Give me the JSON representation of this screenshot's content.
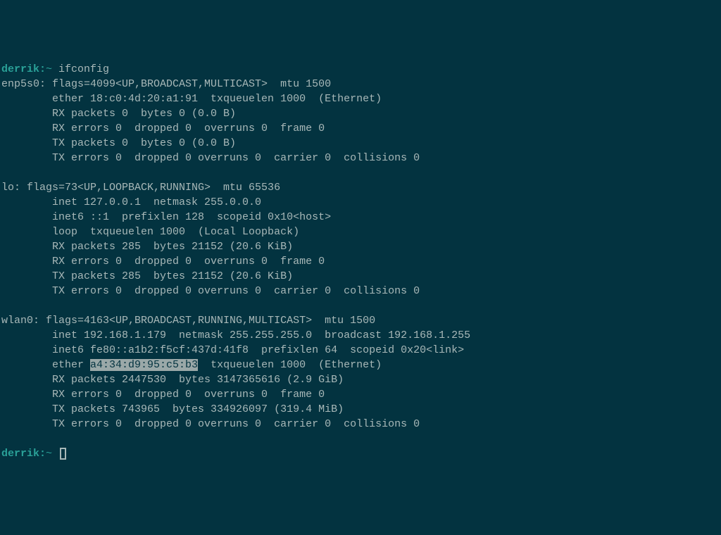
{
  "prompt": {
    "user_host": "derrik:",
    "path": "~",
    "command": "ifconfig"
  },
  "interfaces": {
    "enp5s0": {
      "header": "enp5s0: flags=4099<UP,BROADCAST,MULTICAST>  mtu 1500",
      "ether": "        ether 18:c0:4d:20:a1:91  txqueuelen 1000  (Ethernet)",
      "rx_packets": "        RX packets 0  bytes 0 (0.0 B)",
      "rx_errors": "        RX errors 0  dropped 0  overruns 0  frame 0",
      "tx_packets": "        TX packets 0  bytes 0 (0.0 B)",
      "tx_errors": "        TX errors 0  dropped 0 overruns 0  carrier 0  collisions 0"
    },
    "lo": {
      "header": "lo: flags=73<UP,LOOPBACK,RUNNING>  mtu 65536",
      "inet": "        inet 127.0.0.1  netmask 255.0.0.0",
      "inet6": "        inet6 ::1  prefixlen 128  scopeid 0x10<host>",
      "loop": "        loop  txqueuelen 1000  (Local Loopback)",
      "rx_packets": "        RX packets 285  bytes 21152 (20.6 KiB)",
      "rx_errors": "        RX errors 0  dropped 0  overruns 0  frame 0",
      "tx_packets": "        TX packets 285  bytes 21152 (20.6 KiB)",
      "tx_errors": "        TX errors 0  dropped 0 overruns 0  carrier 0  collisions 0"
    },
    "wlan0": {
      "header": "wlan0: flags=4163<UP,BROADCAST,RUNNING,MULTICAST>  mtu 1500",
      "inet": "        inet 192.168.1.179  netmask 255.255.255.0  broadcast 192.168.1.255",
      "inet6": "        inet6 fe80::a1b2:f5cf:437d:41f8  prefixlen 64  scopeid 0x20<link>",
      "ether_pre": "        ether ",
      "ether_mac": "a4:34:d9:95:c5:b3",
      "ether_post": "  txqueuelen 1000  (Ethernet)",
      "rx_packets": "        RX packets 2447530  bytes 3147365616 (2.9 GiB)",
      "rx_errors": "        RX errors 0  dropped 0  overruns 0  frame 0",
      "tx_packets": "        TX packets 743965  bytes 334926097 (319.4 MiB)",
      "tx_errors": "        TX errors 0  dropped 0 overruns 0  carrier 0  collisions 0"
    }
  },
  "prompt2": {
    "user_host": "derrik:",
    "path": "~"
  }
}
